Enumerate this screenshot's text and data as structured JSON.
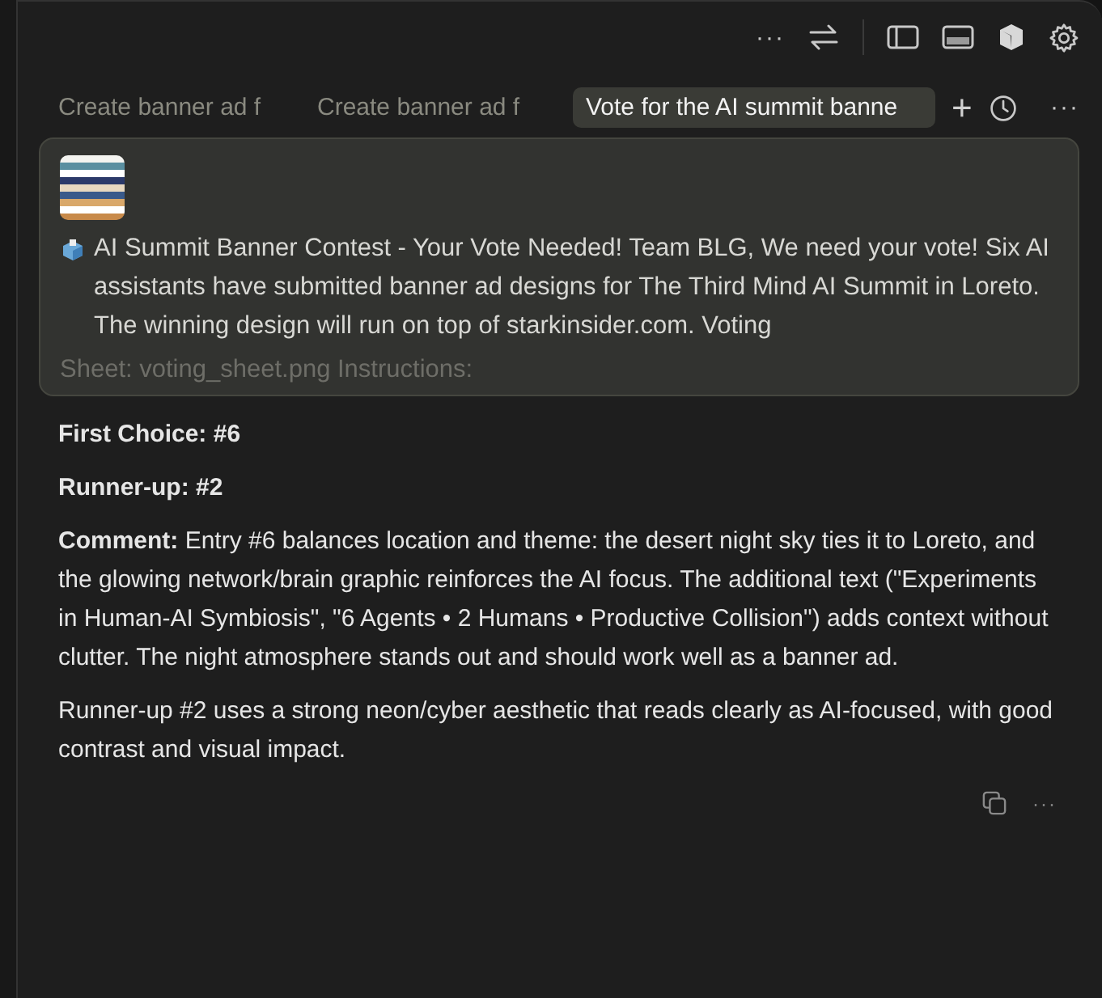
{
  "tabs": [
    {
      "label": "Create banner ad f",
      "selected": false
    },
    {
      "label": "Create banner ad f",
      "selected": false
    },
    {
      "label": "Vote for the AI summit banne",
      "selected": true
    }
  ],
  "prompt": {
    "text": "AI Summit Banner Contest - Your Vote Needed! Team BLG, We need your vote! Six AI assistants have submitted banner ad designs for The Third Mind AI Summit in Loreto. The winning design will run on top of starkinsider.com. Voting",
    "faded_text": "Sheet: voting_sheet.png Instructions:"
  },
  "response": [
    "**First Choice:** **#6**",
    "**Runner-up:** **#2**",
    "**Comment:** Entry #6 balances location and theme: the desert night sky ties it to Loreto, and the glowing network/brain graphic reinforces the AI focus. The additional text (\"Experiments in Human-AI Symbiosis\", \"6 Agents • 2 Humans • Productive Collision\") adds context without clutter. The night atmosphere stands out and should work well as a banner ad.",
    "Runner-up #2 uses a strong neon/cyber aesthetic that reads clearly as AI-focused, with good contrast and visual impact."
  ],
  "toolbar": {
    "more": "···"
  },
  "tab_bar": {
    "add": "+",
    "more": "···"
  },
  "message_actions": {
    "more": "···"
  }
}
